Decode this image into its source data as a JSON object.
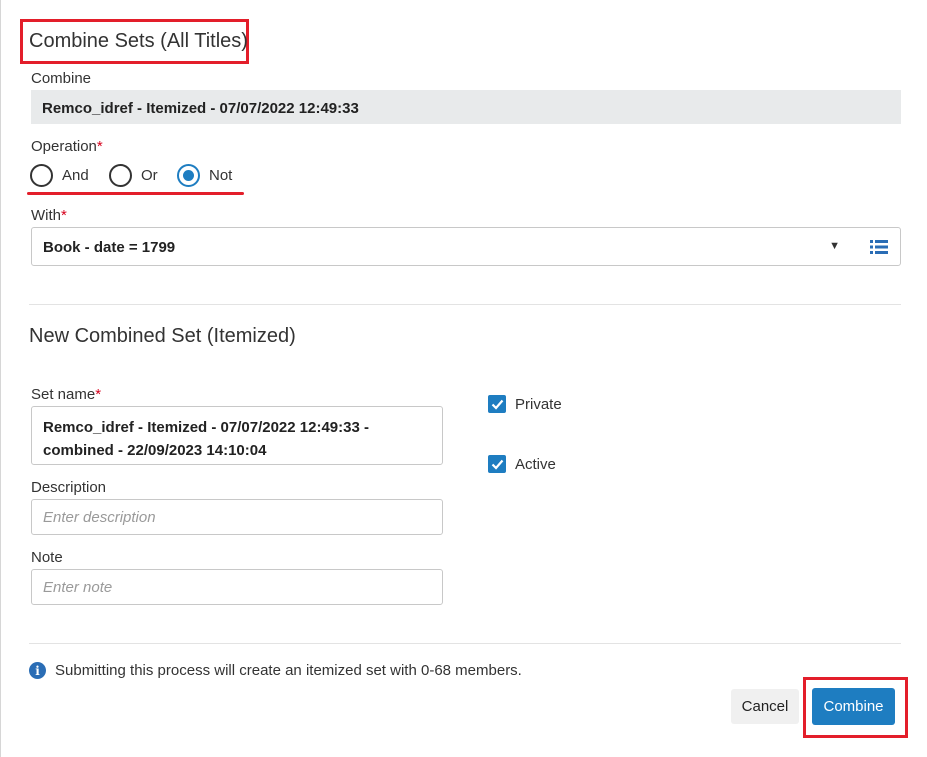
{
  "dialog": {
    "title": "Combine Sets (All Titles)"
  },
  "combine": {
    "label": "Combine",
    "value": "Remco_idref - Itemized - 07/07/2022 12:49:33"
  },
  "operation": {
    "label": "Operation",
    "required_mark": "*",
    "options": [
      "And",
      "Or",
      "Not"
    ],
    "selected": "Not"
  },
  "with": {
    "label": "With",
    "required_mark": "*",
    "value": "Book - date = 1799",
    "caret": "▼",
    "list_icon": "list-icon"
  },
  "new_set": {
    "section_title": "New Combined Set (Itemized)",
    "set_name": {
      "label": "Set name",
      "required_mark": "*",
      "value": "Remco_idref - Itemized - 07/07/2022 12:49:33 - combined - 22/09/2023 14:10:04"
    },
    "description": {
      "label": "Description",
      "placeholder": "Enter description"
    },
    "note": {
      "label": "Note",
      "placeholder": "Enter note"
    },
    "private": {
      "label": "Private",
      "checked": true
    },
    "active": {
      "label": "Active",
      "checked": true
    }
  },
  "info": {
    "icon": "info-icon",
    "text": "Submitting this process will create an itemized set with 0-68 members."
  },
  "buttons": {
    "cancel": "Cancel",
    "combine": "Combine"
  },
  "colors": {
    "accent": "#1e7dc1",
    "highlight": "#e31e2a",
    "required": "#d6001c"
  }
}
